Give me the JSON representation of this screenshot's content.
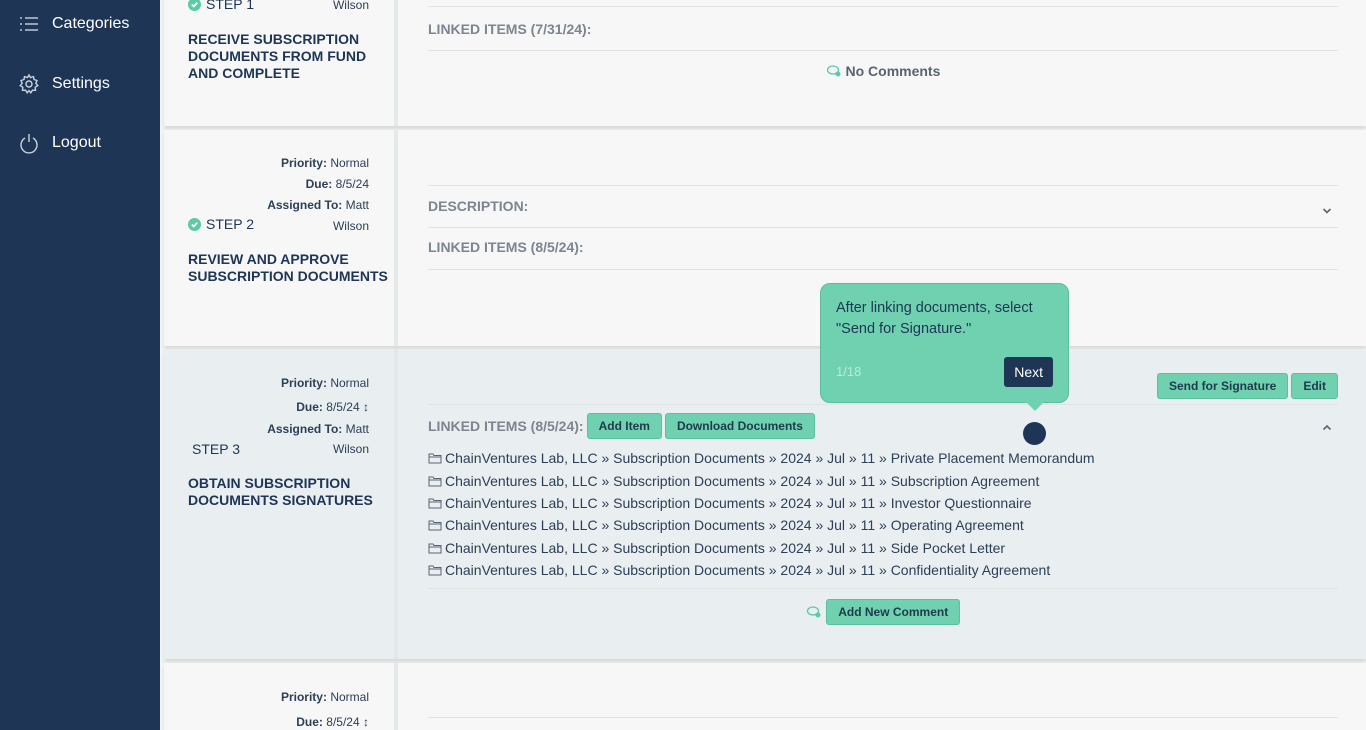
{
  "sidebar": {
    "items": [
      {
        "label": "Categories",
        "icon": "list-icon"
      },
      {
        "label": "Settings",
        "icon": "gear-icon"
      },
      {
        "label": "Logout",
        "icon": "power-icon"
      }
    ]
  },
  "steps": [
    {
      "assigned_to_tail": "Wilson",
      "label": "STEP 1",
      "title": "RECEIVE SUBSCRIPTION DOCUMENTS FROM FUND AND COMPLETE",
      "linked_items_label": "LINKED ITEMS (7/31/24):",
      "comments": "No Comments"
    },
    {
      "priority_label": "Priority:",
      "priority": "Normal",
      "due_label": "Due:",
      "due": "8/5/24",
      "assigned_label": "Assigned To:",
      "assigned_first": "Matt",
      "assigned_last": "Wilson",
      "label": "STEP 2",
      "title": "REVIEW AND APPROVE SUBSCRIPTION DOCUMENTS",
      "description_label": "DESCRIPTION:",
      "linked_items_label": "LINKED ITEMS (8/5/24):"
    },
    {
      "priority_label": "Priority:",
      "priority": "Normal",
      "due_label": "Due:",
      "due": "8/5/24",
      "due_marker": "↕",
      "assigned_label": "Assigned To:",
      "assigned_first": "Matt",
      "assigned_last": "Wilson",
      "label": "STEP 3",
      "title": "OBTAIN SUBSCRIPTION DOCUMENTS SIGNATURES",
      "send_for_signature": "Send for Signature",
      "edit": "Edit",
      "linked_items_label": "LINKED ITEMS (8/5/24):",
      "add_item": "Add Item",
      "download_documents": "Download Documents",
      "documents": [
        "ChainVentures Lab, LLC » Subscription Documents » 2024 » Jul » 11 » Private Placement Memorandum",
        "ChainVentures Lab, LLC » Subscription Documents » 2024 » Jul » 11 » Subscription Agreement",
        "ChainVentures Lab, LLC » Subscription Documents » 2024 » Jul » 11 » Investor Questionnaire",
        "ChainVentures Lab, LLC » Subscription Documents » 2024 » Jul » 11 » Operating Agreement",
        "ChainVentures Lab, LLC » Subscription Documents » 2024 » Jul » 11 » Side Pocket Letter",
        "ChainVentures Lab, LLC » Subscription Documents » 2024 » Jul » 11 » Confidentiality Agreement"
      ],
      "add_comment": "Add New Comment"
    },
    {
      "priority_label": "Priority:",
      "priority": "Normal",
      "due_label": "Due:",
      "due": "8/5/24",
      "due_marker": "↕"
    }
  ],
  "tooltip": {
    "text": "After linking documents, select \"Send for Signature.\"",
    "counter": "1/18",
    "next": "Next"
  },
  "colors": {
    "sidebar": "#1e3556",
    "accent": "#6fd1b0",
    "navy": "#1e3556"
  }
}
